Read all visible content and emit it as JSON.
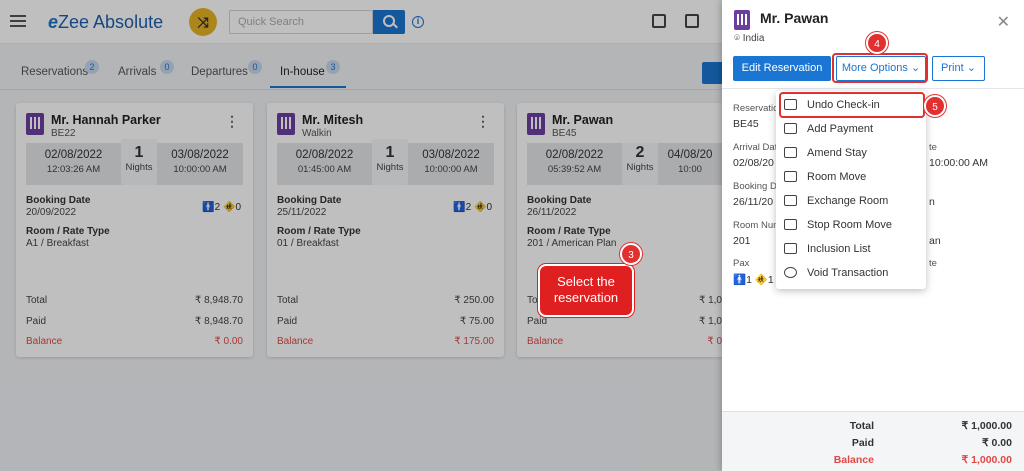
{
  "app": {
    "logo_prefix": "e",
    "logo_text": "Zee Absolute",
    "search_placeholder": "Quick Search"
  },
  "tabs": [
    {
      "label": "Reservations",
      "count": "2"
    },
    {
      "label": "Arrivals",
      "count": "0"
    },
    {
      "label": "Departures",
      "count": "0"
    },
    {
      "label": "In-house",
      "count": "3"
    }
  ],
  "cards": [
    {
      "name": "Mr. Hannah Parker",
      "sub": "BE22",
      "arr_date": "02/08/2022",
      "arr_time": "12:03:26 AM",
      "nights": "1",
      "nights_label": "Nights",
      "dep_date": "03/08/2022",
      "dep_time": "10:00:00 AM",
      "booking_label": "Booking Date",
      "booking_date": "20/09/2022",
      "adults": "2",
      "children": "0",
      "room_label": "Room / Rate Type",
      "room": "A1 / Breakfast",
      "total_label": "Total",
      "total": "₹ 8,948.70",
      "paid_label": "Paid",
      "paid": "₹ 8,948.70",
      "balance_label": "Balance",
      "balance": "₹ 0.00"
    },
    {
      "name": "Mr. Mitesh",
      "sub": "Walkin",
      "arr_date": "02/08/2022",
      "arr_time": "01:45:00 AM",
      "nights": "1",
      "nights_label": "Nights",
      "dep_date": "03/08/2022",
      "dep_time": "10:00:00 AM",
      "booking_label": "Booking Date",
      "booking_date": "25/11/2022",
      "adults": "2",
      "children": "0",
      "room_label": "Room / Rate Type",
      "room": "01 / Breakfast",
      "total_label": "Total",
      "total": "₹ 250.00",
      "paid_label": "Paid",
      "paid": "₹ 75.00",
      "balance_label": "Balance",
      "balance": "₹ 175.00"
    },
    {
      "name": "Mr. Pawan",
      "sub": "BE45",
      "arr_date": "02/08/2022",
      "arr_time": "05:39:52 AM",
      "nights": "2",
      "nights_label": "Nights",
      "dep_date": "04/08/20",
      "dep_time": "10:00",
      "booking_label": "Booking Date",
      "booking_date": "26/11/2022",
      "adults": "1",
      "children": "1",
      "room_label": "Room / Rate Type",
      "room": "201 / American Plan",
      "total_label": "To",
      "total": "₹ 1,0",
      "paid_label": "Paid",
      "paid": "₹ 1,0",
      "balance_label": "Balance",
      "balance": "₹ 0"
    }
  ],
  "callout": {
    "text": "Select the reservation",
    "step": "3"
  },
  "panel": {
    "name": "Mr. Pawan",
    "location": "India",
    "edit_btn": "Edit Reservation",
    "more_btn": "More Options",
    "print_btn": "Print",
    "step4": "4",
    "step5": "5",
    "fields": [
      {
        "label": "Reservatio",
        "value": "BE45"
      },
      {
        "label": "Arrival Dat",
        "value": "02/08/20"
      },
      {
        "label": "te",
        "value": "10:00:00 AM"
      },
      {
        "label": "Booking Da",
        "value": "26/11/20"
      },
      {
        "label": "n",
        "value": ""
      },
      {
        "label": "Room Num",
        "value": "201"
      },
      {
        "label": "an",
        "value": ""
      },
      {
        "label": "Pax",
        "value": ""
      },
      {
        "label": "te",
        "value": ""
      }
    ],
    "pax_adults": "1",
    "pax_children": "1",
    "footer": {
      "total_label": "Total",
      "total": "₹ 1,000.00",
      "paid_label": "Paid",
      "paid": "₹ 0.00",
      "balance_label": "Balance",
      "balance": "₹ 1,000.00"
    }
  },
  "menu": [
    {
      "label": "Undo Check-in",
      "icon": "undo-checkin-icon"
    },
    {
      "label": "Add Payment",
      "icon": "payment-icon"
    },
    {
      "label": "Amend Stay",
      "icon": "calendar-icon"
    },
    {
      "label": "Room Move",
      "icon": "room-move-icon"
    },
    {
      "label": "Exchange Room",
      "icon": "exchange-room-icon"
    },
    {
      "label": "Stop Room Move",
      "icon": "hand-stop-icon"
    },
    {
      "label": "Inclusion List",
      "icon": "inclusion-list-icon"
    },
    {
      "label": "Void Transaction",
      "icon": "void-icon"
    }
  ],
  "colors": {
    "primary": "#1a76d2",
    "accent": "#e7b325",
    "danger": "#e03030",
    "brand_purple": "#6b3fa0"
  }
}
